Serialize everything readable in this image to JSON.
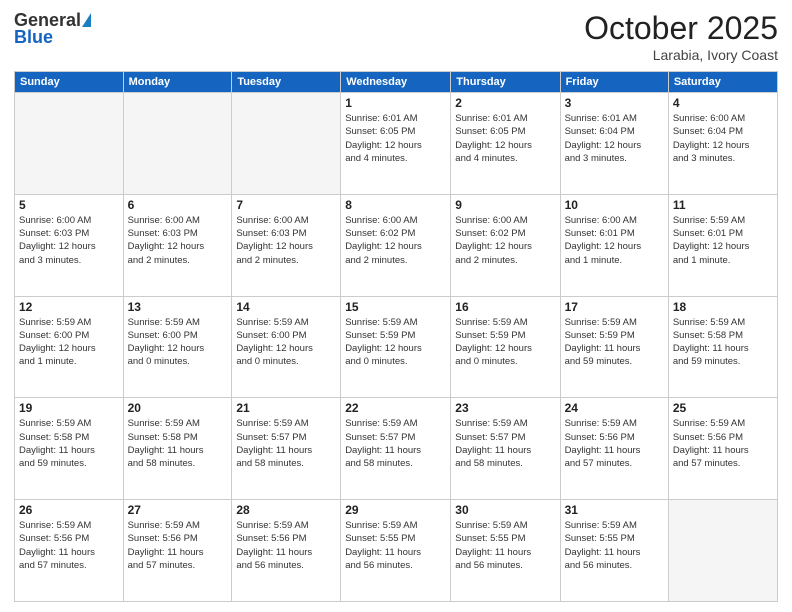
{
  "header": {
    "logo_general": "General",
    "logo_blue": "Blue",
    "month": "October 2025",
    "location": "Larabia, Ivory Coast"
  },
  "weekdays": [
    "Sunday",
    "Monday",
    "Tuesday",
    "Wednesday",
    "Thursday",
    "Friday",
    "Saturday"
  ],
  "weeks": [
    [
      {
        "day": "",
        "info": ""
      },
      {
        "day": "",
        "info": ""
      },
      {
        "day": "",
        "info": ""
      },
      {
        "day": "1",
        "info": "Sunrise: 6:01 AM\nSunset: 6:05 PM\nDaylight: 12 hours\nand 4 minutes."
      },
      {
        "day": "2",
        "info": "Sunrise: 6:01 AM\nSunset: 6:05 PM\nDaylight: 12 hours\nand 4 minutes."
      },
      {
        "day": "3",
        "info": "Sunrise: 6:01 AM\nSunset: 6:04 PM\nDaylight: 12 hours\nand 3 minutes."
      },
      {
        "day": "4",
        "info": "Sunrise: 6:00 AM\nSunset: 6:04 PM\nDaylight: 12 hours\nand 3 minutes."
      }
    ],
    [
      {
        "day": "5",
        "info": "Sunrise: 6:00 AM\nSunset: 6:03 PM\nDaylight: 12 hours\nand 3 minutes."
      },
      {
        "day": "6",
        "info": "Sunrise: 6:00 AM\nSunset: 6:03 PM\nDaylight: 12 hours\nand 2 minutes."
      },
      {
        "day": "7",
        "info": "Sunrise: 6:00 AM\nSunset: 6:03 PM\nDaylight: 12 hours\nand 2 minutes."
      },
      {
        "day": "8",
        "info": "Sunrise: 6:00 AM\nSunset: 6:02 PM\nDaylight: 12 hours\nand 2 minutes."
      },
      {
        "day": "9",
        "info": "Sunrise: 6:00 AM\nSunset: 6:02 PM\nDaylight: 12 hours\nand 2 minutes."
      },
      {
        "day": "10",
        "info": "Sunrise: 6:00 AM\nSunset: 6:01 PM\nDaylight: 12 hours\nand 1 minute."
      },
      {
        "day": "11",
        "info": "Sunrise: 5:59 AM\nSunset: 6:01 PM\nDaylight: 12 hours\nand 1 minute."
      }
    ],
    [
      {
        "day": "12",
        "info": "Sunrise: 5:59 AM\nSunset: 6:00 PM\nDaylight: 12 hours\nand 1 minute."
      },
      {
        "day": "13",
        "info": "Sunrise: 5:59 AM\nSunset: 6:00 PM\nDaylight: 12 hours\nand 0 minutes."
      },
      {
        "day": "14",
        "info": "Sunrise: 5:59 AM\nSunset: 6:00 PM\nDaylight: 12 hours\nand 0 minutes."
      },
      {
        "day": "15",
        "info": "Sunrise: 5:59 AM\nSunset: 5:59 PM\nDaylight: 12 hours\nand 0 minutes."
      },
      {
        "day": "16",
        "info": "Sunrise: 5:59 AM\nSunset: 5:59 PM\nDaylight: 12 hours\nand 0 minutes."
      },
      {
        "day": "17",
        "info": "Sunrise: 5:59 AM\nSunset: 5:59 PM\nDaylight: 11 hours\nand 59 minutes."
      },
      {
        "day": "18",
        "info": "Sunrise: 5:59 AM\nSunset: 5:58 PM\nDaylight: 11 hours\nand 59 minutes."
      }
    ],
    [
      {
        "day": "19",
        "info": "Sunrise: 5:59 AM\nSunset: 5:58 PM\nDaylight: 11 hours\nand 59 minutes."
      },
      {
        "day": "20",
        "info": "Sunrise: 5:59 AM\nSunset: 5:58 PM\nDaylight: 11 hours\nand 58 minutes."
      },
      {
        "day": "21",
        "info": "Sunrise: 5:59 AM\nSunset: 5:57 PM\nDaylight: 11 hours\nand 58 minutes."
      },
      {
        "day": "22",
        "info": "Sunrise: 5:59 AM\nSunset: 5:57 PM\nDaylight: 11 hours\nand 58 minutes."
      },
      {
        "day": "23",
        "info": "Sunrise: 5:59 AM\nSunset: 5:57 PM\nDaylight: 11 hours\nand 58 minutes."
      },
      {
        "day": "24",
        "info": "Sunrise: 5:59 AM\nSunset: 5:56 PM\nDaylight: 11 hours\nand 57 minutes."
      },
      {
        "day": "25",
        "info": "Sunrise: 5:59 AM\nSunset: 5:56 PM\nDaylight: 11 hours\nand 57 minutes."
      }
    ],
    [
      {
        "day": "26",
        "info": "Sunrise: 5:59 AM\nSunset: 5:56 PM\nDaylight: 11 hours\nand 57 minutes."
      },
      {
        "day": "27",
        "info": "Sunrise: 5:59 AM\nSunset: 5:56 PM\nDaylight: 11 hours\nand 57 minutes."
      },
      {
        "day": "28",
        "info": "Sunrise: 5:59 AM\nSunset: 5:56 PM\nDaylight: 11 hours\nand 56 minutes."
      },
      {
        "day": "29",
        "info": "Sunrise: 5:59 AM\nSunset: 5:55 PM\nDaylight: 11 hours\nand 56 minutes."
      },
      {
        "day": "30",
        "info": "Sunrise: 5:59 AM\nSunset: 5:55 PM\nDaylight: 11 hours\nand 56 minutes."
      },
      {
        "day": "31",
        "info": "Sunrise: 5:59 AM\nSunset: 5:55 PM\nDaylight: 11 hours\nand 56 minutes."
      },
      {
        "day": "",
        "info": ""
      }
    ]
  ]
}
